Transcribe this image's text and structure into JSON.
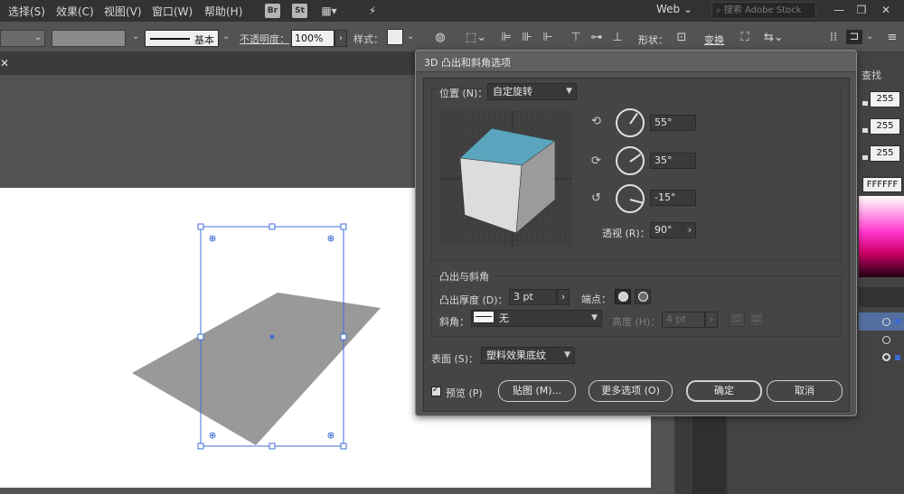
{
  "menubar": {
    "items": [
      "选择(S)",
      "效果(C)",
      "视图(V)",
      "窗口(W)",
      "帮助(H)"
    ],
    "bridge_label": "Br",
    "stock_label": "St",
    "workspace": "Web",
    "search_placeholder": "搜索 Adobe Stock"
  },
  "controlbar": {
    "stroke_profile": "基本",
    "opacity_label": "不透明度：",
    "opacity_value": "100%",
    "style_label": "样式：",
    "shape_label": "形状：",
    "transform_label": "变换"
  },
  "panel": {
    "tab_label": "查找",
    "rgb_values": [
      "255",
      "255",
      "255"
    ],
    "hex_value": "FFFFFF"
  },
  "dialog": {
    "title": "3D 凸出和斜角选项",
    "position_label": "位置 (N)：",
    "position_value": "自定旋转",
    "x_rotation": "55°",
    "y_rotation": "35°",
    "z_rotation": "-15°",
    "perspective_label": "透视 (R)：",
    "perspective_value": "90°",
    "extrude_section_label": "凸出与斜角",
    "extrude_depth_label": "凸出厚度 (D)：",
    "extrude_depth_value": "3 pt",
    "cap_label": "端点：",
    "bevel_label": "斜角：",
    "bevel_value": "无",
    "height_label": "高度 (H)：",
    "height_value": "4 pt",
    "surface_label": "表面 (S)：",
    "surface_value": "塑料效果底纹",
    "preview_label": "预览 (P)",
    "map_art_button": "贴图 (M)...",
    "more_options_button": "更多选项 (O)",
    "ok_button": "确定",
    "cancel_button": "取消"
  },
  "colors": {
    "cube_top": "#5aa5bd",
    "cube_left": "#dcdcdc",
    "cube_right": "#9b9b9b",
    "selection": "#3f6fd6"
  }
}
